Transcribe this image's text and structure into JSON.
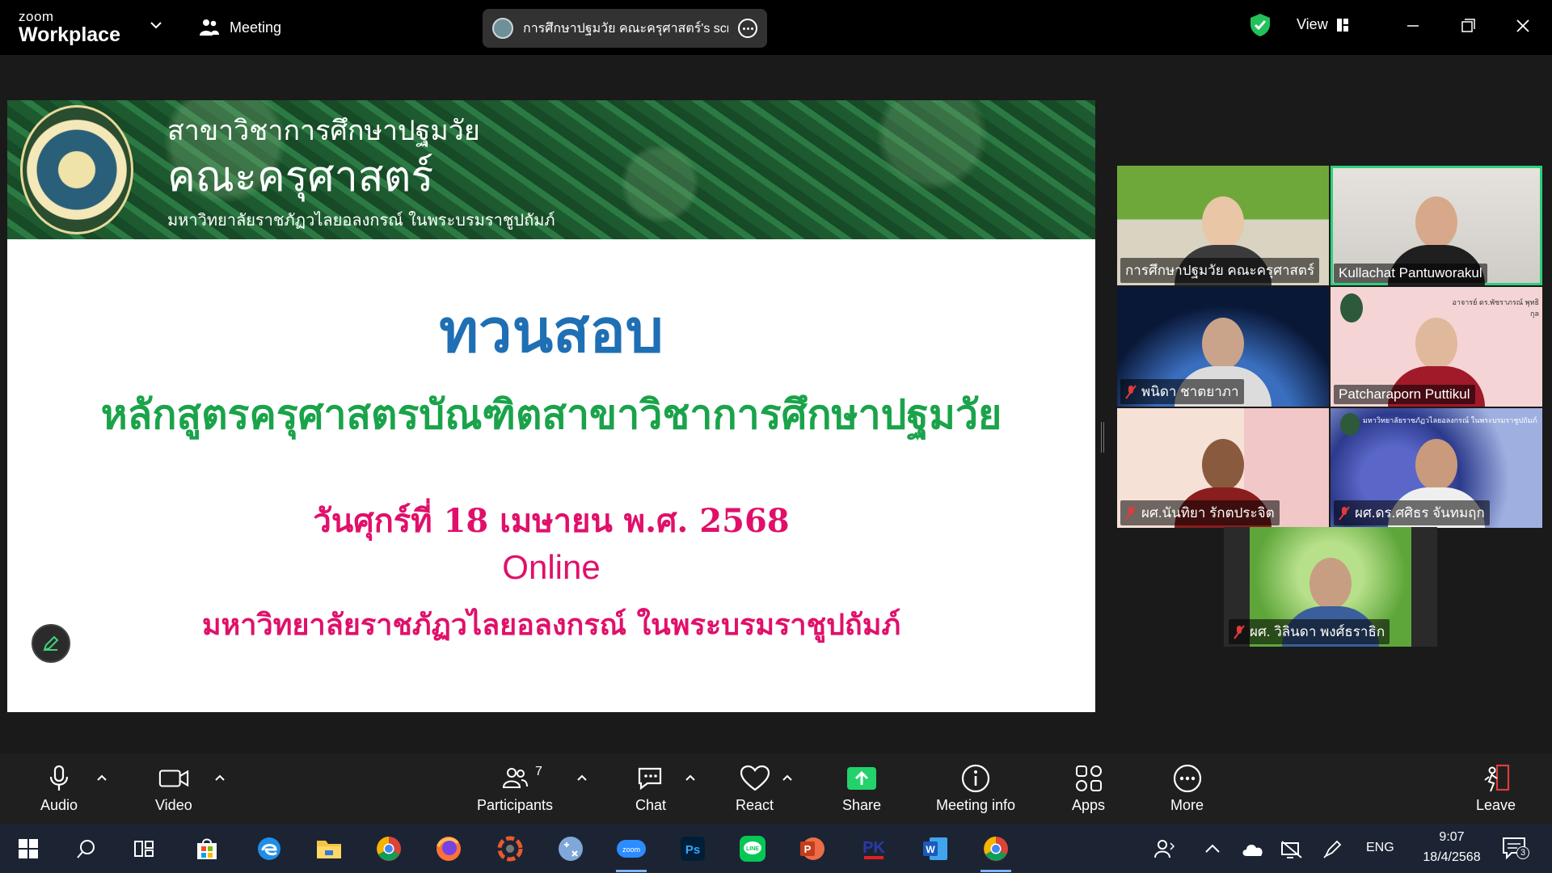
{
  "app": {
    "brand_line1": "zoom",
    "brand_line2": "Workplace",
    "meeting_label": "Meeting",
    "share_title": "การศึกษาปฐมวัย คณะครุศาสตร์'s scre",
    "view_label": "View"
  },
  "slide": {
    "header_line1": "สาขาวิชาการศึกษาปฐมวัย",
    "header_line2": "คณะครุศาสตร์",
    "header_line3": "มหาวิทยาลัยราชภัฏวไลยอลงกรณ์ ในพระบรมราชูปถัมภ์",
    "title": "ทวนสอบ",
    "course": "หลักสูตรครุศาสตรบัณฑิตสาขาวิชาการศึกษาปฐมวัย",
    "date": "วันศุกร์ที่ 18  เมษายน  พ.ศ. 2568",
    "mode": "Online",
    "university": "มหาวิทยาลัยราชภัฏวไลยอลงกรณ์ ในพระบรมราชูปถัมภ์"
  },
  "participants": [
    {
      "name": "การศึกษาปฐมวัย คณะครุศาสตร์",
      "muted": false
    },
    {
      "name": "Kullachat Pantuworakul",
      "muted": false,
      "active": true
    },
    {
      "name": "พนิดา ชาตยาภา",
      "muted": true
    },
    {
      "name": "Patcharaporn Puttikul",
      "muted": false
    },
    {
      "name": "ผศ.นันทิยา รักตประจิต",
      "muted": true
    },
    {
      "name": "ผศ.ดร.ศศิธร จันทมฤก",
      "muted": true
    },
    {
      "name": "ผศ. วิลินดา  พงศ์ธราธิก",
      "muted": true
    }
  ],
  "tile_text": {
    "patcharaporn_card": "อาจารย์ ดร.พัชราภรณ์ พุทธิกุล",
    "sasithorn_banner": "มหาวิทยาลัยราชภัฏวไลยอลงกรณ์ ในพระบรมราชูปถัมภ์"
  },
  "toolbar": {
    "audio": "Audio",
    "video": "Video",
    "participants": "Participants",
    "participants_count": "7",
    "chat": "Chat",
    "react": "React",
    "share": "Share",
    "meeting_info": "Meeting info",
    "apps": "Apps",
    "more": "More",
    "leave": "Leave"
  },
  "taskbar": {
    "language": "ENG",
    "time": "9:07",
    "date": "18/4/2568",
    "notifications": "3"
  },
  "colors": {
    "zoom_green": "#2ecf7a",
    "slide_title_blue": "#1f6fb4",
    "slide_course_green": "#1aa34a",
    "slide_pink": "#e0106a",
    "share_green": "#23d26b"
  }
}
